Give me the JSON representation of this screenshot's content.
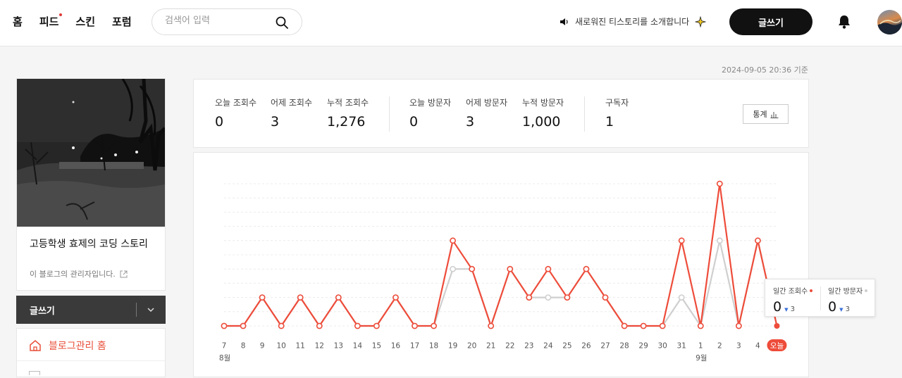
{
  "nav": {
    "items": [
      {
        "label": "홈",
        "new": false
      },
      {
        "label": "피드",
        "new": true
      },
      {
        "label": "스킨",
        "new": false
      },
      {
        "label": "포럼",
        "new": false
      }
    ]
  },
  "search": {
    "placeholder": "검색어 입력",
    "icon": "search-icon"
  },
  "notice": {
    "text": "새로워진 티스토리를 소개합니다",
    "icon": "speaker-icon"
  },
  "header": {
    "write_label": "글쓰기",
    "bell_icon": "bell-icon"
  },
  "timestamp": "2024-09-05 20:36 기준",
  "profile": {
    "blog_name": "고등학생 효제의 코딩 스토리",
    "blog_desc": "이 블로그의 관리자입니다."
  },
  "sidebar": {
    "write_label": "글쓰기",
    "home_label": "블로그관리 홈"
  },
  "stats": {
    "items": [
      {
        "label": "오늘 조회수",
        "value": "0"
      },
      {
        "label": "어제 조회수",
        "value": "3"
      },
      {
        "label": "누적 조회수",
        "value": "1,276"
      },
      {
        "label": "오늘 방문자",
        "value": "0"
      },
      {
        "label": "어제 방문자",
        "value": "3"
      },
      {
        "label": "누적 방문자",
        "value": "1,000"
      },
      {
        "label": "구독자",
        "value": "1"
      }
    ],
    "button_label": "통계"
  },
  "colors": {
    "views": "#ee4c3a",
    "visitors": "#cfcfcf"
  },
  "chart_data": {
    "type": "line",
    "categories": [
      "7",
      "8",
      "9",
      "10",
      "11",
      "12",
      "13",
      "14",
      "15",
      "16",
      "17",
      "18",
      "19",
      "20",
      "21",
      "22",
      "23",
      "24",
      "25",
      "26",
      "27",
      "28",
      "29",
      "30",
      "31",
      "1",
      "2",
      "3",
      "4",
      "오늘"
    ],
    "month_labels": [
      {
        "index": 0,
        "label": "8월"
      },
      {
        "index": 25,
        "label": "9월"
      }
    ],
    "series": [
      {
        "name": "일간 조회수",
        "values": [
          0,
          0,
          2,
          0,
          2,
          0,
          2,
          0,
          0,
          2,
          0,
          0,
          6,
          4,
          0,
          4,
          2,
          4,
          2,
          4,
          2,
          0,
          0,
          0,
          6,
          0,
          10,
          0,
          6,
          0
        ]
      },
      {
        "name": "일간 방문자",
        "values": [
          0,
          0,
          2,
          0,
          2,
          0,
          2,
          0,
          0,
          2,
          0,
          0,
          4,
          4,
          0,
          4,
          2,
          2,
          2,
          4,
          2,
          0,
          0,
          0,
          2,
          0,
          6,
          0,
          6,
          0
        ]
      }
    ],
    "ylim": [
      0,
      10
    ],
    "grid": true
  },
  "tooltip": {
    "views": {
      "label": "일간 조회수",
      "value": "0",
      "delta": "3"
    },
    "visitors": {
      "label": "일간 방문자",
      "value": "0",
      "delta": "3"
    }
  }
}
